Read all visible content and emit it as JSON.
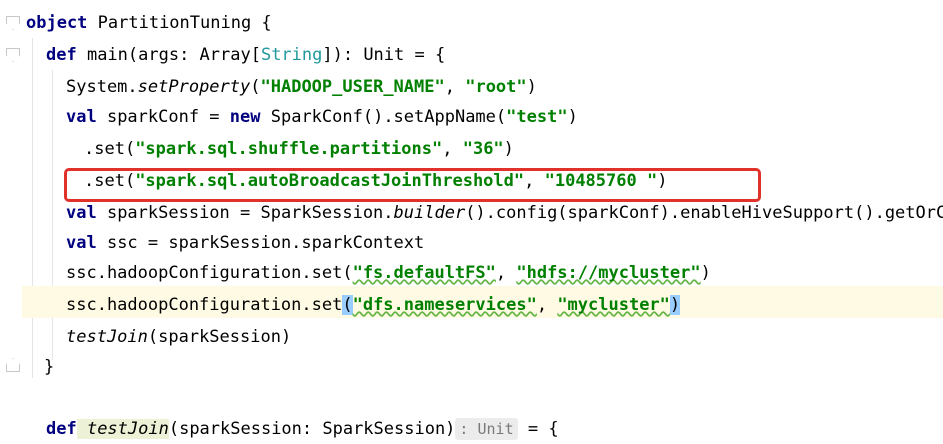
{
  "editor": {
    "lines": {
      "l1": {
        "kw": "object",
        "name": " PartitionTuning {"
      },
      "l2": {
        "kw": "def",
        "pre": " main(args: Array[",
        "type": "String",
        "post": "]): Unit = {"
      },
      "l3": {
        "pre": "System.",
        "method": "setProperty",
        "open": "(",
        "s1": "\"HADOOP_USER_NAME\"",
        "comma": ", ",
        "s2": "\"root\"",
        "close": ")"
      },
      "l4": {
        "kw": "val",
        "mid": " sparkConf = ",
        "kw2": "new",
        "post": " SparkConf().setAppName(",
        "s1": "\"test\"",
        "close": ")"
      },
      "l5": {
        "pre": ".set(",
        "s1": "\"spark.sql.shuffle.partitions\"",
        "comma": ", ",
        "s2": "\"36\"",
        "close": ")"
      },
      "l6": {
        "pre": ".set(",
        "s1": "\"spark.sql.autoBroadcastJoinThreshold\"",
        "comma": ", ",
        "s2": "\"10485760 \"",
        "close": ")"
      },
      "l7": {
        "kw": "val",
        "pre": " sparkSession = SparkSession.",
        "method": "builder",
        "post": "().config(sparkConf).enableHiveSupport().getOrCre"
      },
      "l8": {
        "kw": "val",
        "post": " ssc = sparkSession.sparkContext"
      },
      "l9": {
        "pre": "ssc.hadoopConfiguration.set(",
        "s1": "\"fs.defaultFS\"",
        "comma": ", ",
        "s2": "\"hdfs://mycluster\"",
        "close": ")"
      },
      "l10": {
        "pre": "ssc.hadoopConfiguration.set",
        "open": "(",
        "s1": "\"dfs.nameservices\"",
        "comma": ", ",
        "s2": "\"mycluster\"",
        "close": ")"
      },
      "l11": {
        "method": "testJoin",
        "post": "(sparkSession)"
      },
      "l12": {
        "brace": "}"
      },
      "l14": {
        "kw": "def",
        "method": " testJoin",
        "post": "(sparkSession: SparkSession)",
        "hint": ": Unit",
        "tail": " = {"
      }
    }
  }
}
